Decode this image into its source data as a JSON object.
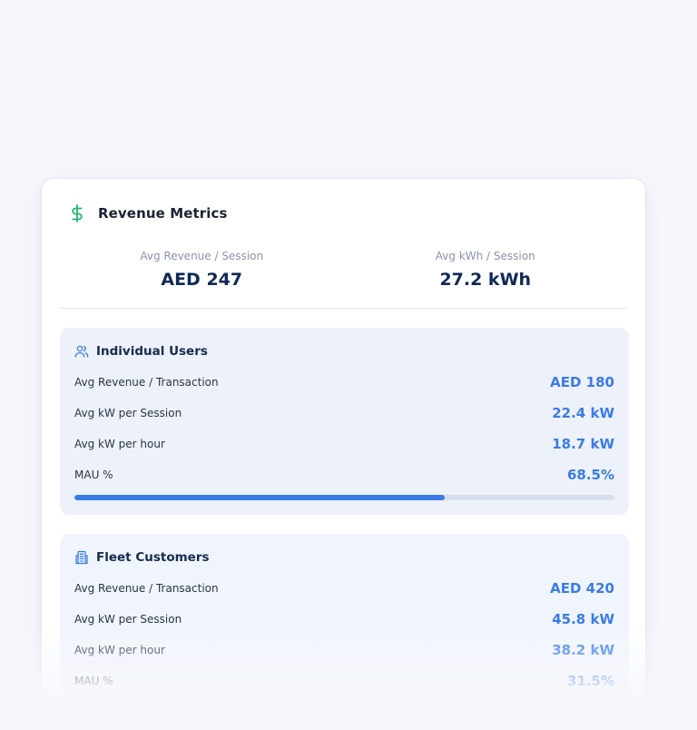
{
  "card": {
    "title": "Revenue Metrics",
    "icon": "dollar-icon",
    "accent_color": "#22b573"
  },
  "summary": [
    {
      "label": "Avg Revenue / Session",
      "value": "AED 247"
    },
    {
      "label": "Avg kWh / Session",
      "value": "27.2 kWh"
    }
  ],
  "segments": {
    "individual": {
      "title": "Individual Users",
      "icon": "users-icon",
      "metrics": [
        {
          "label": "Avg Revenue / Transaction",
          "value": "AED 180"
        },
        {
          "label": "Avg kW per Session",
          "value": "22.4 kW"
        },
        {
          "label": "Avg kW per hour",
          "value": "18.7 kW"
        },
        {
          "label": "MAU %",
          "value": "68.5%"
        }
      ],
      "mau_progress_percent": 68.5
    },
    "fleet": {
      "title": "Fleet Customers",
      "icon": "building-icon",
      "metrics": [
        {
          "label": "Avg Revenue / Transaction",
          "value": "AED 420"
        },
        {
          "label": "Avg kW per Session",
          "value": "45.8 kW"
        },
        {
          "label": "Avg kW per hour",
          "value": "38.2 kW"
        },
        {
          "label": "MAU %",
          "value": "31.5%"
        }
      ]
    }
  },
  "colors": {
    "value_blue": "#3a7be6",
    "progress_fill": "#3b7ae8",
    "progress_track": "#d6deec"
  }
}
